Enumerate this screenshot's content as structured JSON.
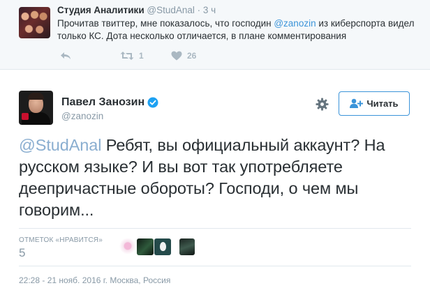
{
  "parent_tweet": {
    "author_name": "Студия Аналитики",
    "author_handle": "@StudAnal",
    "separator": "·",
    "time": "3 ч",
    "text_before": "Прочитав твиттер, мне показалось, что господин ",
    "mention": "@zanozin",
    "text_after": " из киберспорта видел только КС. Дота несколько отличается, в плане комментирования",
    "retweet_count": "1",
    "like_count": "26",
    "icons": [
      "reply-icon",
      "retweet-icon",
      "heart-icon"
    ]
  },
  "main_tweet": {
    "author_name": "Павел Занозин",
    "author_handle": "@zanozin",
    "verified": true,
    "follow_label": "Читать",
    "mention": "@StudAnal",
    "text": " Ребят, вы официальный аккаунт? На русском языке? И вы вот так употребляете деепричастные обороты? Господи, о чем мы говорим...",
    "likes_label": "ОТМЕТОК «НРАВИТСЯ»",
    "likes_count": "5",
    "liker_avatars": 5,
    "date": "22:28 - 21 нояб. 2016 г. Москва, Россия",
    "icons": [
      "gear-icon",
      "follow-person-icon",
      "verified-badge-icon"
    ]
  },
  "colors": {
    "link": "#3b94d9",
    "muted": "#8899a6",
    "text": "#292f33",
    "parent_bg": "#f5f8fa"
  }
}
